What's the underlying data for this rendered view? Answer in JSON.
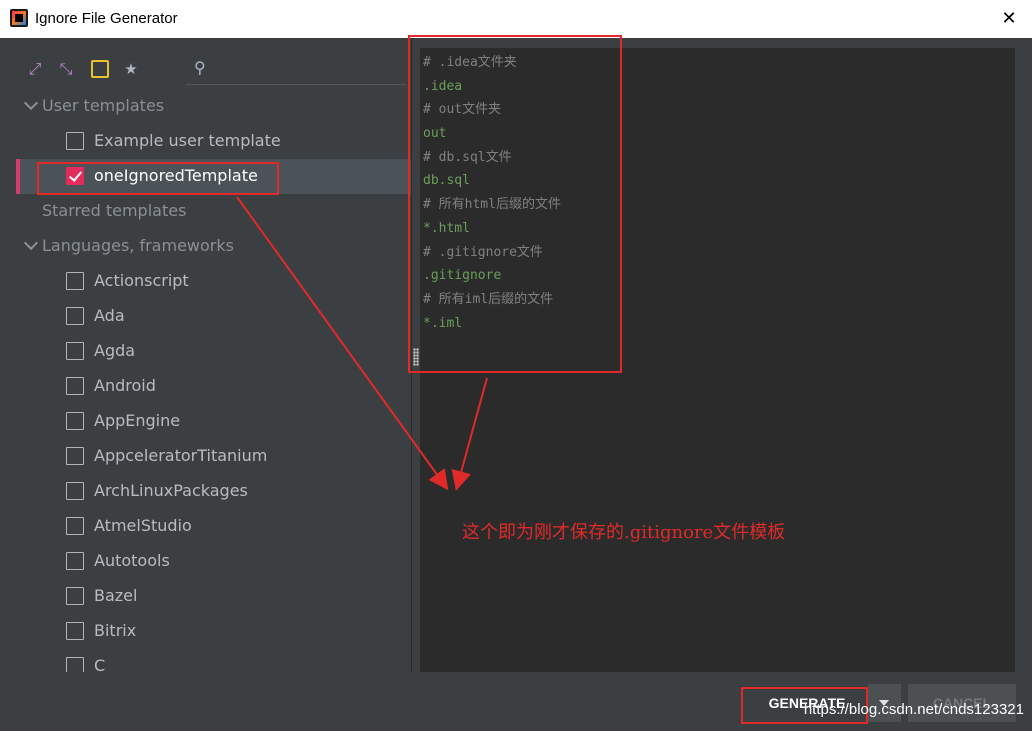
{
  "window": {
    "title": "Ignore File Generator",
    "close_glyph": "✕"
  },
  "toolbar": {
    "icons": [
      "expand-all-icon",
      "collapse-all-icon",
      "toggle-square-icon",
      "star-icon"
    ],
    "expand_glyph": "⤢",
    "collapse_glyph": "⤡",
    "star_glyph": "★",
    "search_glyph": "⚲",
    "search_value": ""
  },
  "tree": {
    "user_templates": "User templates",
    "example_user_template": "Example user template",
    "one_ignored_template": "oneIgnoredTemplate",
    "starred_templates": "Starred templates",
    "languages_frameworks": "Languages, frameworks",
    "languages": [
      "Actionscript",
      "Ada",
      "Agda",
      "Android",
      "AppEngine",
      "AppceleratorTitanium",
      "ArchLinuxPackages",
      "AtmelStudio",
      "Autotools",
      "Bazel",
      "Bitrix",
      "C"
    ]
  },
  "editor": {
    "lines": [
      {
        "text": "# .idea文件夹",
        "kind": "comment"
      },
      {
        "text": ".idea",
        "kind": "pattern"
      },
      {
        "text": "# out文件夹",
        "kind": "comment"
      },
      {
        "text": "out",
        "kind": "pattern"
      },
      {
        "text": "# db.sql文件",
        "kind": "comment"
      },
      {
        "text": "db.sql",
        "kind": "pattern"
      },
      {
        "text": "# 所有html后缀的文件",
        "kind": "comment"
      },
      {
        "text": "*.html",
        "kind": "pattern"
      },
      {
        "text": "# .gitignore文件",
        "kind": "comment"
      },
      {
        "text": ".gitignore",
        "kind": "pattern"
      },
      {
        "text": "# 所有iml后缀的文件",
        "kind": "comment"
      },
      {
        "text": "*.iml",
        "kind": "pattern"
      }
    ]
  },
  "annotation": {
    "text": "这个即为刚才保存的.gitignore文件模板",
    "color": "#e02a2a"
  },
  "buttons": {
    "generate": "GENERATE",
    "cancel": "CANCEL"
  },
  "watermark": "https://blog.csdn.net/cnds123321",
  "colors": {
    "accent": "#d63b6e",
    "checkbox_checked": "#e22d5c",
    "annotation_red": "#e02a2a",
    "comment": "#808080",
    "pattern": "#6a9e5b"
  }
}
